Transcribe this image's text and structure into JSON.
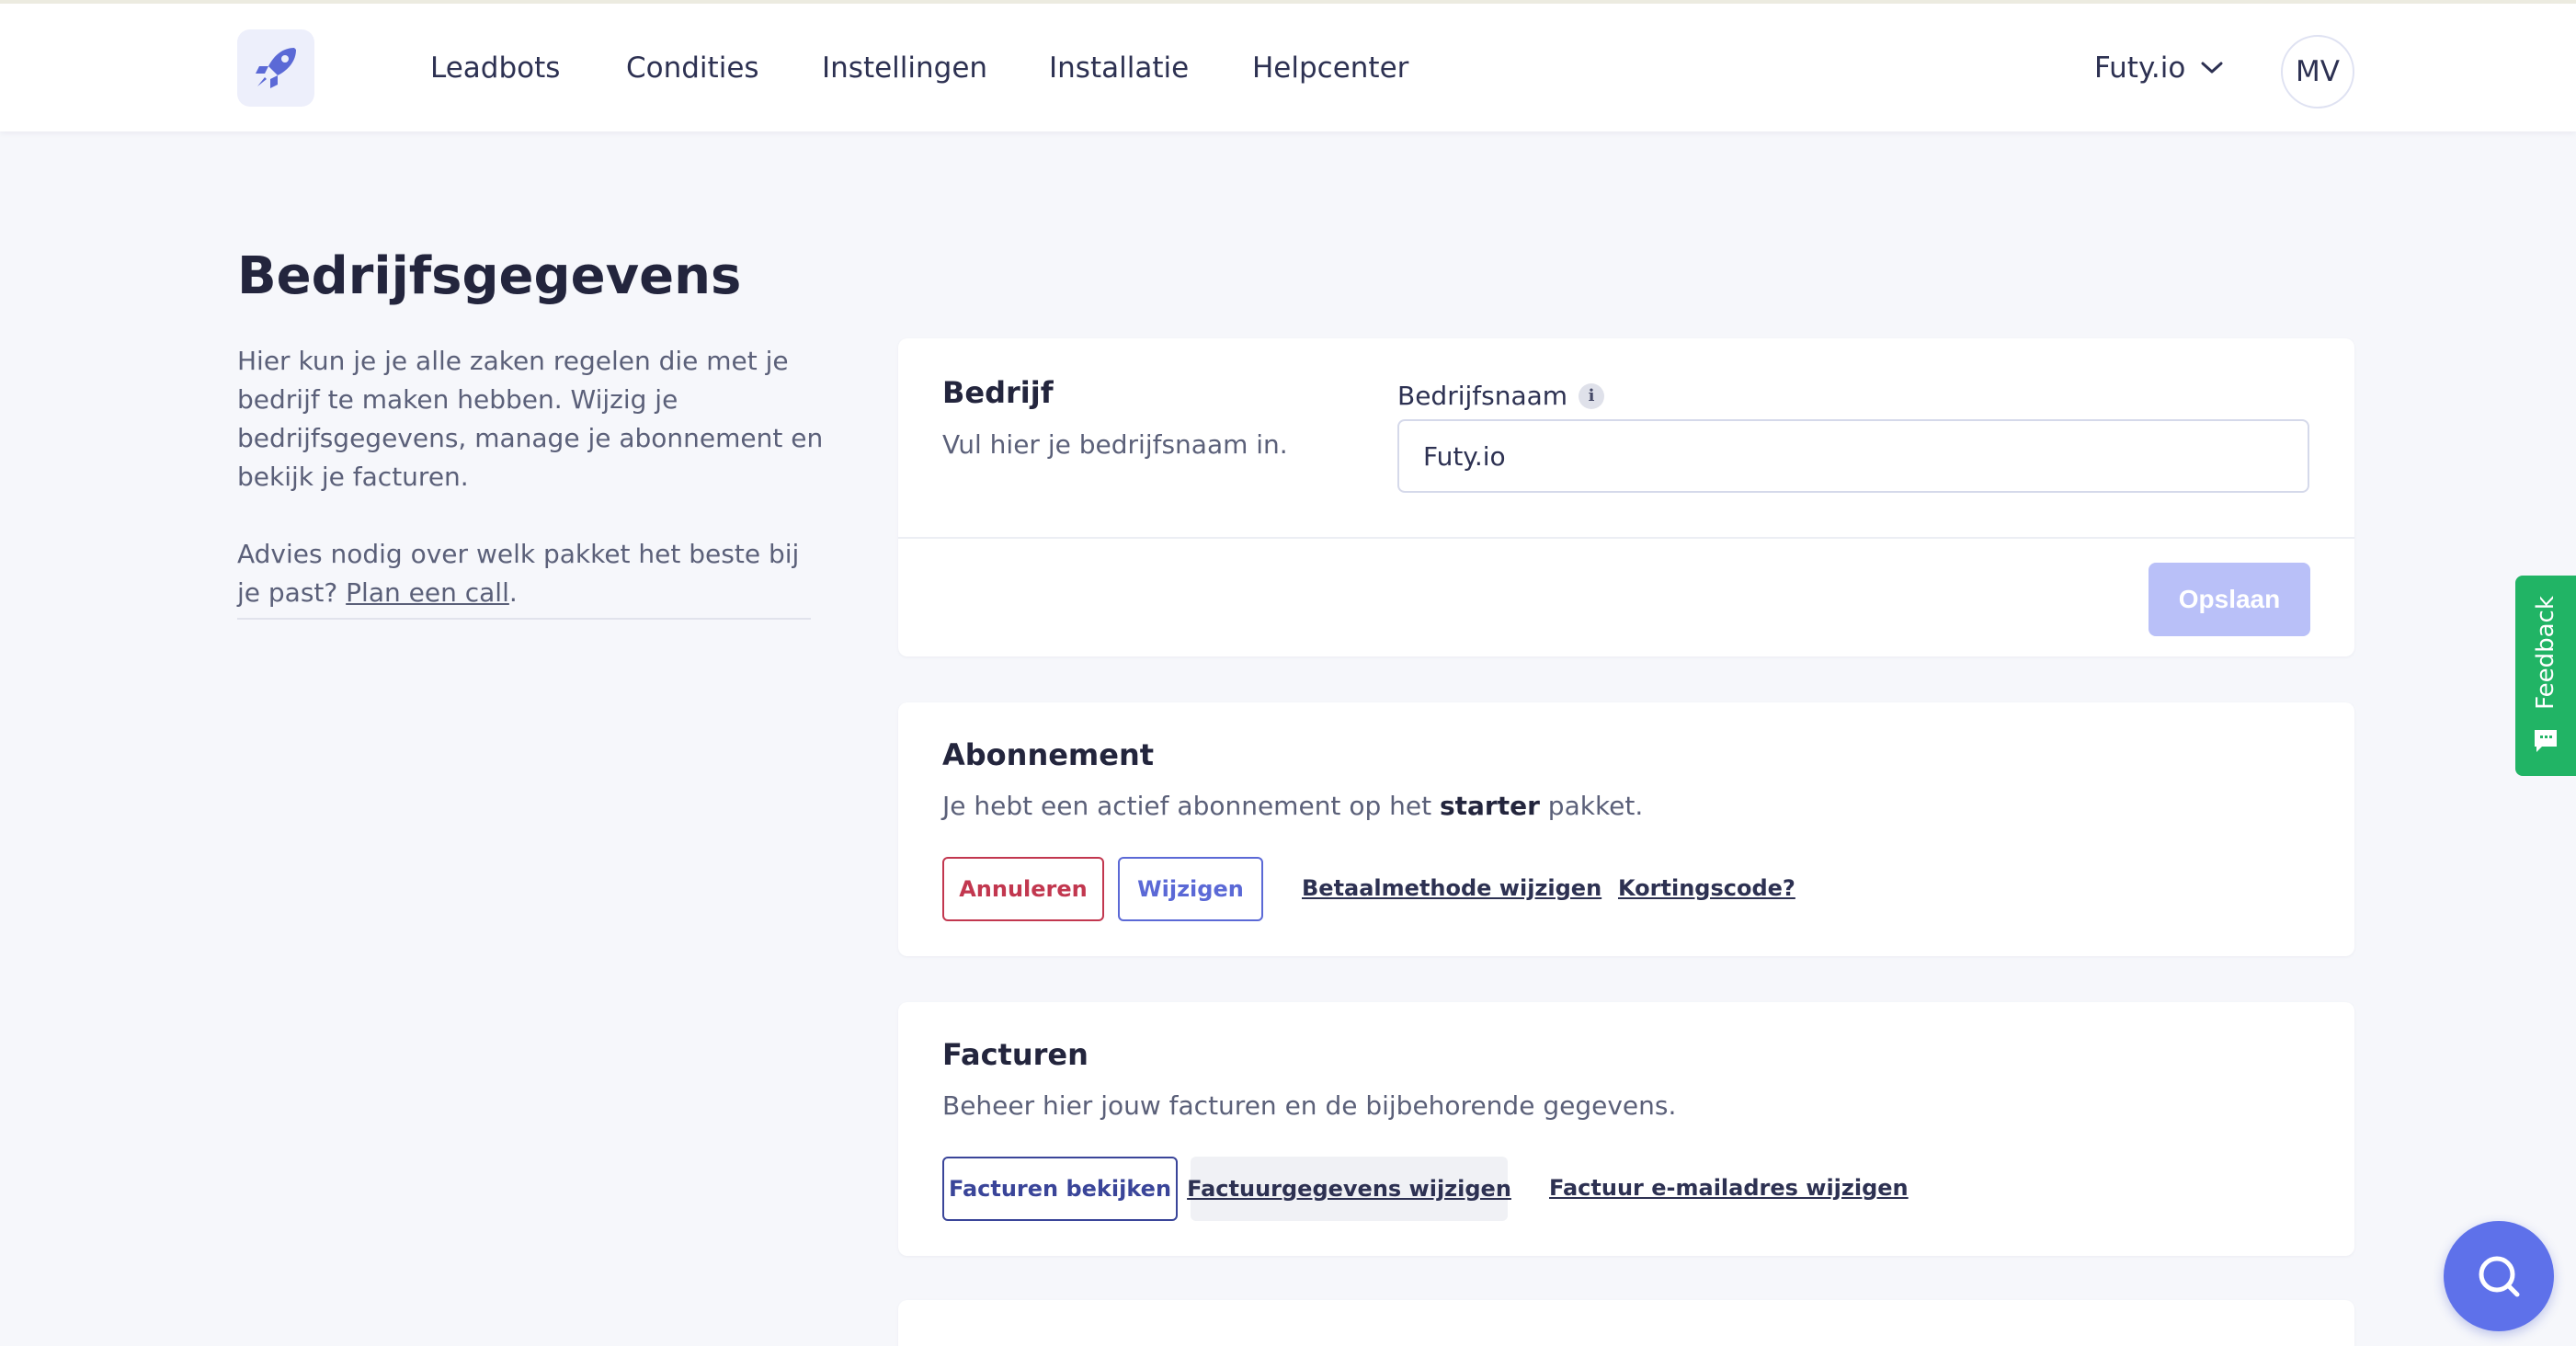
{
  "navbar": {
    "items": [
      {
        "label": "Leadbots"
      },
      {
        "label": "Condities"
      },
      {
        "label": "Instellingen"
      },
      {
        "label": "Installatie"
      },
      {
        "label": "Helpcenter"
      }
    ],
    "account_name": "Futy.io",
    "avatar_initials": "MV"
  },
  "intro": {
    "title": "Bedrijfsgegevens",
    "paragraph1": "Hier kun je je alle zaken regelen die met je bedrijf te maken hebben. Wijzig je bedrijfsgegevens, manage je abonnement en bekijk je facturen.",
    "paragraph2_prefix": "Advies nodig over welk pakket het beste bij je past? ",
    "paragraph2_link": "Plan een call",
    "paragraph2_suffix": "."
  },
  "company_card": {
    "title": "Bedrijf",
    "description": "Vul hier je bedrijfsnaam in.",
    "field_label": "Bedrijfsnaam",
    "info_icon_glyph": "i",
    "field_value": "Futy.io",
    "save_label": "Opslaan"
  },
  "subscription_card": {
    "title": "Abonnement",
    "description_prefix": "Je hebt een actief abonnement op het ",
    "plan": "starter",
    "description_suffix": " pakket.",
    "cancel_label": "Annuleren",
    "change_label": "Wijzigen",
    "payment_link": "Betaalmethode wijzigen",
    "discount_link": "Kortingscode?"
  },
  "invoices_card": {
    "title": "Facturen",
    "description": "Beheer hier jouw facturen en de bijbehorende gegevens.",
    "view_label": "Facturen bekijken",
    "details_label": "Factuurgegevens wijzigen",
    "email_link": "Factuur e-mailadres wijzigen"
  },
  "feedback_tab": {
    "label": "Feedback"
  },
  "colors": {
    "primary": "#5b69d6",
    "danger": "#c2374f",
    "feedback": "#21b465",
    "help": "#5e71ea",
    "save_disabled": "#b9c0f8"
  }
}
